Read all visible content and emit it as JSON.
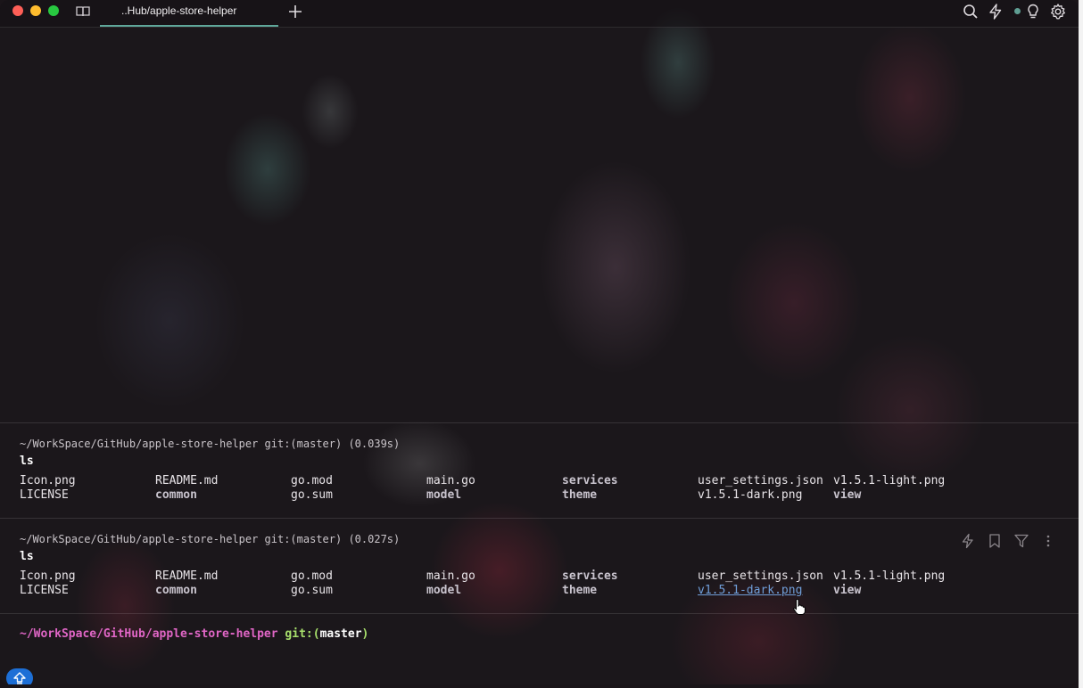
{
  "tab": {
    "title": "..Hub/apple-store-helper"
  },
  "blocks": [
    {
      "cwd": "~/WorkSpace/GitHub/apple-store-helper git:(master) (0.039s)",
      "command": "ls",
      "rows": [
        [
          "Icon.png",
          "README.md",
          "go.mod",
          "main.go",
          "services",
          "user_settings.json",
          "v1.5.1-light.png"
        ],
        [
          "LICENSE",
          "common",
          "go.sum",
          "model",
          "theme",
          "v1.5.1-dark.png",
          "view"
        ]
      ]
    },
    {
      "cwd": "~/WorkSpace/GitHub/apple-store-helper git:(master) (0.027s)",
      "command": "ls",
      "rows": [
        [
          "Icon.png",
          "README.md",
          "go.mod",
          "main.go",
          "services",
          "user_settings.json",
          "v1.5.1-light.png"
        ],
        [
          "LICENSE",
          "common",
          "go.sum",
          "model",
          "theme",
          "v1.5.1-dark.png",
          "view"
        ]
      ]
    }
  ],
  "prompt": {
    "path": "~/WorkSpace/GitHub/apple-store-helper",
    "git": "git:(",
    "branch": "master",
    "git_close": ")"
  },
  "icons": {
    "titlebar": [
      "book-icon",
      "plus-icon",
      "search-icon",
      "bolt-icon",
      "lightbulb-icon",
      "gear-icon"
    ],
    "block_actions": [
      "bolt-icon",
      "bookmark-icon",
      "filter-icon",
      "more-vertical-icon"
    ],
    "cursor": "pointer-hand-icon",
    "badge": "upgrade-arrow-icon"
  },
  "colors": {
    "tab_accent": "#5fa79a",
    "prompt_path": "#e066c6",
    "prompt_git": "#a8e06c",
    "link": "#6f9ed8",
    "badge": "#1d6fd6"
  }
}
